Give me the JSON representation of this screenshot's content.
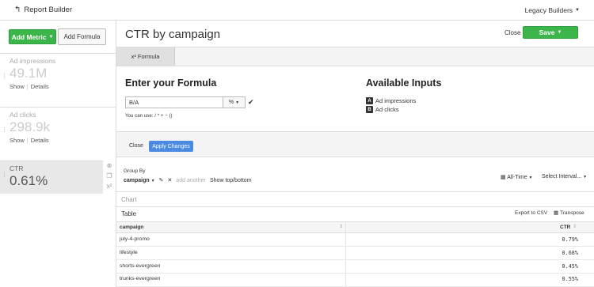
{
  "topbar": {
    "back_label": "Report Builder",
    "account_label": "Legacy Builders"
  },
  "left": {
    "add_metric_label": "Add Metric",
    "add_formula_label": "Add Formula",
    "metrics": [
      {
        "name": "Ad impressions",
        "value": "49.1M",
        "show": "Show",
        "details": "Details"
      },
      {
        "name": "Ad clicks",
        "value": "298.9k",
        "show": "Show",
        "details": "Details"
      },
      {
        "name": "CTR",
        "value": "0.61%"
      }
    ]
  },
  "header": {
    "title": "CTR by campaign",
    "close_label": "Close",
    "save_label": "Save"
  },
  "editor": {
    "tab_label": "x² Formula",
    "enter_heading": "Enter your Formula",
    "formula_value": "B/A",
    "format_value": "%",
    "help_text": "You can use: / * + − ()",
    "available_heading": "Available Inputs",
    "inputs": [
      {
        "badge": "A",
        "label": "Ad impressions"
      },
      {
        "badge": "B",
        "label": "Ad clicks"
      }
    ],
    "close_label": "Close",
    "apply_label": "Apply Changes"
  },
  "groupby": {
    "label": "Group By",
    "field": "campaign",
    "add_another": "add another",
    "show_top": "Show top/bottom",
    "time_label": "All-Time",
    "interval_label": "Select Interval..."
  },
  "chart_label": "Chart",
  "table": {
    "label": "Table",
    "export_label": "Export to CSV",
    "transpose_label": "Transpose",
    "columns": [
      "campaign",
      "CTR"
    ],
    "rows": [
      {
        "campaign": "july-4-promo",
        "ctr": "0.79%"
      },
      {
        "campaign": "lifestyle",
        "ctr": "0.68%"
      },
      {
        "campaign": "shorts-evergreen",
        "ctr": "0.45%"
      },
      {
        "campaign": "trunks-evergreen",
        "ctr": "0.55%"
      }
    ]
  },
  "colors": {
    "green": "#3cb54a",
    "blue": "#4a8ae0"
  }
}
